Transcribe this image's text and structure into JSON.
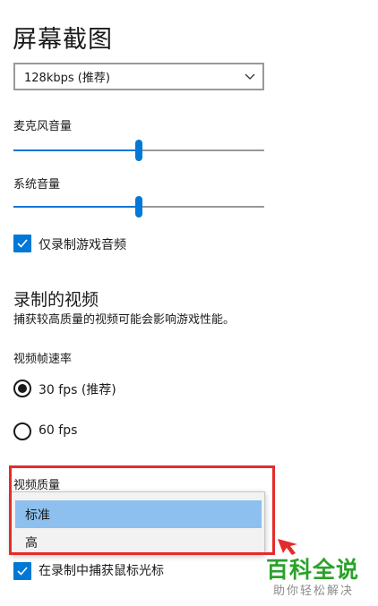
{
  "page": {
    "title": "屏幕截图"
  },
  "audio_quality_select": {
    "value": "128kbps (推荐)"
  },
  "microphone": {
    "label": "麦克风音量",
    "volume_percent": 50
  },
  "system": {
    "label": "系统音量",
    "volume_percent": 50
  },
  "game_audio_only": {
    "label": "仅录制游戏音频",
    "checked": true
  },
  "recorded_video": {
    "section_title": "录制的视频",
    "description": "捕获较高质量的视频可能会影响游戏性能。",
    "frame_rate": {
      "label": "视频帧速率",
      "options": [
        {
          "label": "30 fps (推荐)",
          "selected": true
        },
        {
          "label": "60 fps",
          "selected": false
        }
      ]
    },
    "quality": {
      "label": "视频质量",
      "options": [
        {
          "label": "标准",
          "selected": true
        },
        {
          "label": "高",
          "selected": false
        }
      ]
    },
    "capture_cursor": {
      "label": "在录制中捕获鼠标光标",
      "checked": true
    }
  },
  "watermark": {
    "logo_text": "百科全说",
    "sub_text": "助你轻松解决"
  },
  "colors": {
    "accent": "#0078d7",
    "highlight_box": "#e42b2b",
    "watermark_green": "#2aa22a",
    "selected_option": "#8dc0ee"
  }
}
